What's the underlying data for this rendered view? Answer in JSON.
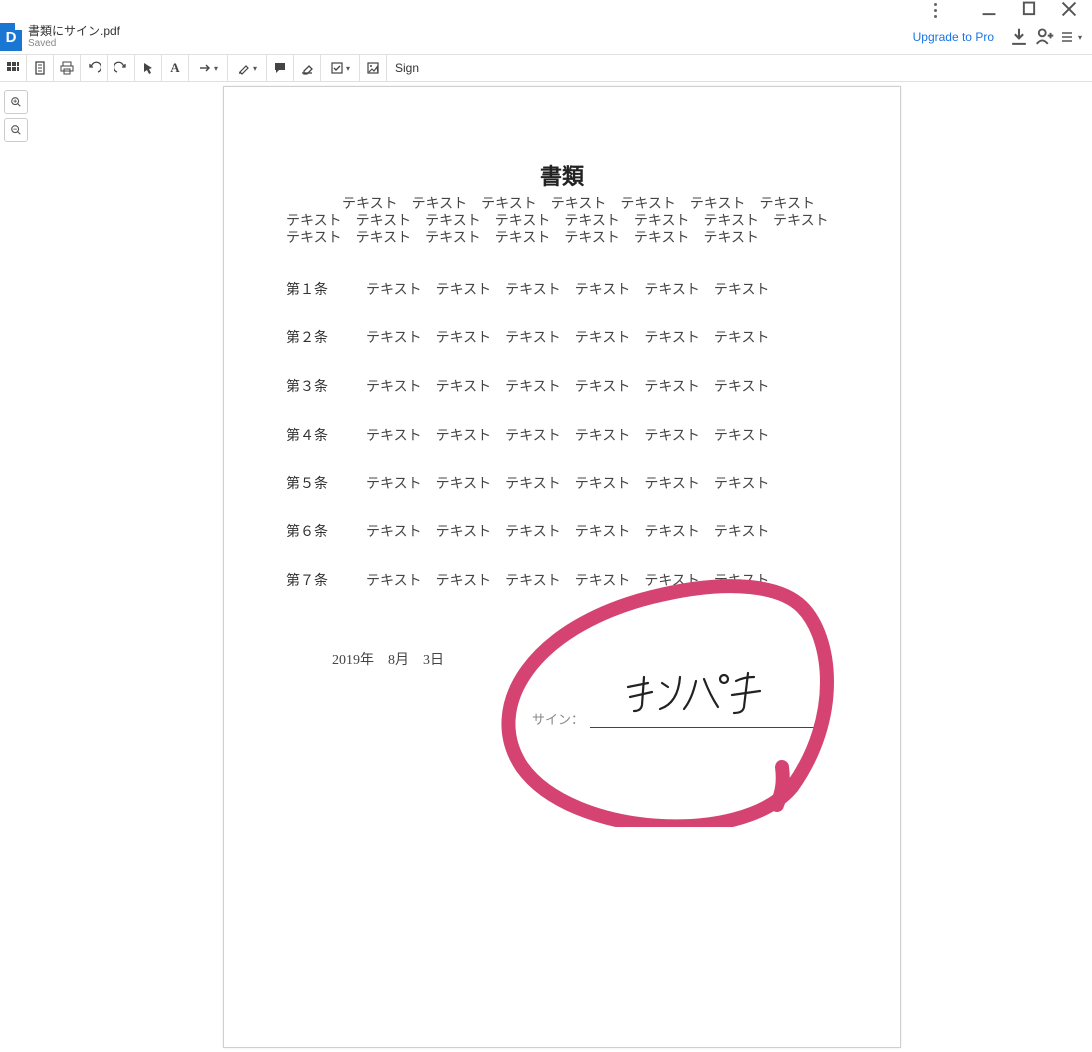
{
  "window": {
    "filename": "書類にサイン.pdf",
    "status": "Saved",
    "doc_icon_letter": "D",
    "upgrade_label": "Upgrade to Pro"
  },
  "toolbar": {
    "sign_label": "Sign"
  },
  "document": {
    "title": "書類",
    "intro_indent": "　　　　",
    "intro": "テキスト　テキスト　テキスト　テキスト　テキスト　テキスト　テキスト　テキスト　テキスト　テキスト　テキスト　テキスト　テキスト　テキスト　テキスト　テキスト　テキスト　テキスト　テキスト　テキスト　テキスト　テキスト",
    "articles": [
      {
        "label": "第１条",
        "body": "テキスト　テキスト　テキスト　テキスト　テキスト　テキスト"
      },
      {
        "label": "第２条",
        "body": "テキスト　テキスト　テキスト　テキスト　テキスト　テキスト"
      },
      {
        "label": "第３条",
        "body": "テキスト　テキスト　テキスト　テキスト　テキスト　テキスト"
      },
      {
        "label": "第４条",
        "body": "テキスト　テキスト　テキスト　テキスト　テキスト　テキスト"
      },
      {
        "label": "第５条",
        "body": "テキスト　テキスト　テキスト　テキスト　テキスト　テキスト"
      },
      {
        "label": "第６条",
        "body": "テキスト　テキスト　テキスト　テキスト　テキスト　テキスト"
      },
      {
        "label": "第７条",
        "body": "テキスト　テキスト　テキスト　テキスト　テキスト　テキスト"
      }
    ],
    "date": "2019年　8月　3日",
    "sign_label": "サイン：",
    "signature_text": "サンパチ"
  },
  "annotation": {
    "circle_color": "#d54372"
  }
}
